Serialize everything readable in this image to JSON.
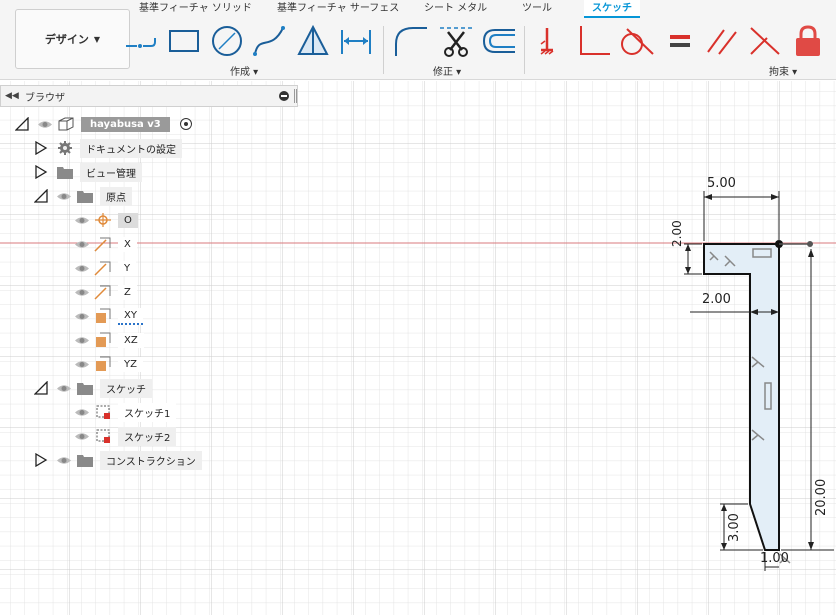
{
  "toolbar": {
    "design_button": "デザイン",
    "tabs": [
      {
        "label": "基準フィーチャ ソリッド"
      },
      {
        "label": "基準フィーチャ サーフェス"
      },
      {
        "label": "シート メタル"
      },
      {
        "label": "ツール"
      },
      {
        "label": "スケッチ",
        "active": true
      }
    ],
    "groups": {
      "create": "作成 ▾",
      "modify": "修正 ▾",
      "constraints": "拘束 ▾"
    },
    "create_tools": [
      "line-icon",
      "rectangle-icon",
      "circle-icon",
      "spline-icon",
      "triangle-icon",
      "dimension-icon"
    ],
    "modify_tools": [
      "fillet-icon",
      "trim-icon",
      "offset-icon"
    ],
    "constraint_tools": [
      "fix-icon",
      "perpendicular-icon",
      "tangent-icon",
      "equal-icon",
      "parallel-icon",
      "coincident-icon",
      "lock-icon"
    ],
    "accent_color": "#0696d7",
    "constraint_color": "#d9312b"
  },
  "browser": {
    "title": "ブラウザ",
    "root": {
      "label": "hayabusa v3"
    },
    "items": [
      {
        "label": "ドキュメントの設定"
      },
      {
        "label": "ビュー管理"
      },
      {
        "label": "原点"
      },
      {
        "label": "O"
      },
      {
        "label": "X"
      },
      {
        "label": "Y"
      },
      {
        "label": "Z"
      },
      {
        "label": "XY"
      },
      {
        "label": "XZ"
      },
      {
        "label": "YZ"
      },
      {
        "label": "スケッチ"
      },
      {
        "label": "スケッチ1"
      },
      {
        "label": "スケッチ2"
      },
      {
        "label": "コンストラクション"
      }
    ]
  },
  "sketch": {
    "dimensions": {
      "top_width": "5.00",
      "left_height": "2.00",
      "inner_width": "2.00",
      "total_height": "20.00",
      "bevel_height": "3.00",
      "bottom_width": "1.00"
    }
  }
}
